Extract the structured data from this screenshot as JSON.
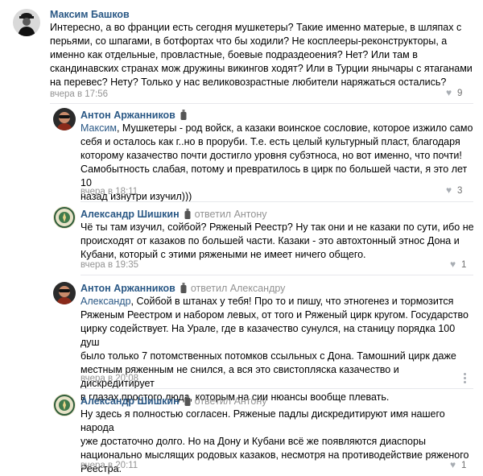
{
  "comments": [
    {
      "author": "Максим Башков",
      "reply_to": "",
      "mention": "",
      "lines": [
        "Интересно, а во франции есть сегодня мушкетеры? Такие именно матерые, в шляпах с",
        "перьями, со шпагами, в ботфортах что бы ходили? Не косплееры-реконструкторы, а",
        "именно как отдельные, провластные, боевые подраздеоения? Нет? Или там в",
        "скандинавских странах мож дружины викингов ходят? Или в Турции янычары с ятаганами",
        "на перевес? Нету? Только у нас великовозрастные любители наряжаться остались?"
      ],
      "time": "вчера в 17:56",
      "likes": "9"
    },
    {
      "author": "Антон Аржанников",
      "reply_to": "",
      "mention": "Максим",
      "lines": [
        ", Мушкетеры - род войск, а казаки воинское сословие, которое изжило само",
        "себя и осталось как г..но в проруби. Т.е. есть целый культурный пласт, благодаря",
        "которому казачество почти достигло уровня субэтноса, но вот именно, что почти!",
        "Самобытность слабая, потому и превратилось в цирк по большей части, я это лет 10",
        "назад изнутри изучил)))"
      ],
      "time": "вчера в 18:11",
      "likes": "3"
    },
    {
      "author": "Александр Шишкин",
      "reply_to": "ответил Антону",
      "mention": "",
      "lines": [
        "Чё ты там изучил, сойбой? Ряженый Реестр? Ну так они и не казаки по сути, ибо не",
        "происходят от казаков по большей части. Казаки - это автохтонный этнос Дона и",
        "Кубани, который с этими ряжеными не имеет ничего общего."
      ],
      "time": "вчера в 19:35",
      "likes": "1"
    },
    {
      "author": "Антон Аржанников",
      "reply_to": "ответил Александру",
      "mention": "Александр",
      "lines": [
        ", Сойбой в штанах у тебя! Про то и пишу, что этногенез и тормозится",
        "Ряженым Реестром и набором левых, от того и Ряженый цирк кругом. Государство",
        "цирку содействует. На Урале, где в казачество сунулся, на станицу порядка 100 душ",
        "было только 7 потомственных потомков ссыльных с Дона. Тамошний цирк даже",
        "местным ряженным не снился, а вся это свистопляска казачество и дискредитирует",
        "в глазах простого люда, которым на сии нюансы вообще плевать."
      ],
      "time": "вчера в 20:08",
      "likes": ""
    },
    {
      "author": "Александр Шишкин",
      "reply_to": "ответил Антону",
      "mention": "",
      "lines": [
        "Ну здесь я полностью согласен. Ряженые падлы дискредитируют имя нашего народа",
        "уже достаточно долго. Но на Дону и Кубани всё же появляются диаспоры",
        "национально мыслящих родовых казаков, несмотря на противодействие ряженого",
        "Реестра."
      ],
      "time": "вчера в 20:11",
      "likes": "1"
    }
  ],
  "colors": {
    "link": "#2a5885",
    "muted": "#939393",
    "divider": "#e7e8ec",
    "heart": "#a8adb3"
  },
  "icons": {
    "like": "heart-icon",
    "badge": "bottle-icon",
    "menu": "more-vertical-icon"
  }
}
